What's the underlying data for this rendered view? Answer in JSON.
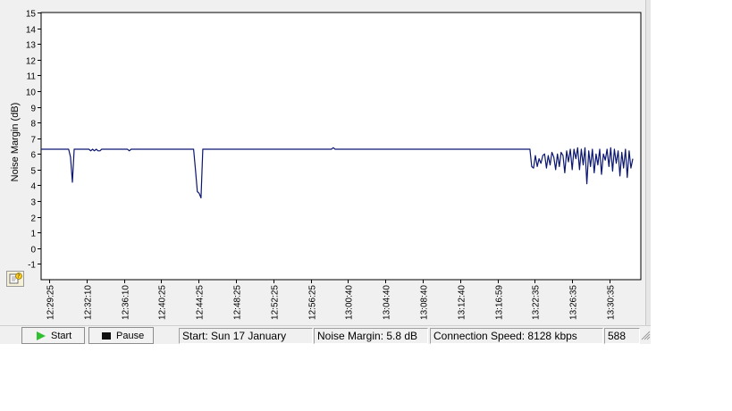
{
  "chart_data": {
    "type": "line",
    "ylabel": "Noise Margin (dB)",
    "ylim": [
      -2,
      15
    ],
    "yticks": [
      "15",
      "14",
      "13",
      "12",
      "11",
      "10",
      "9",
      "8",
      "7",
      "6",
      "5",
      "4",
      "3",
      "2",
      "1",
      "0",
      "-1"
    ],
    "x_tick_labels": [
      "12:29:25",
      "12:32:10",
      "12:36:10",
      "12:40:25",
      "12:44:25",
      "12:48:25",
      "12:52:25",
      "12:56:25",
      "13:00:40",
      "13:04:40",
      "13:08:40",
      "13:12:40",
      "13:16:59",
      "13:22:35",
      "13:26:35",
      "13:30:35"
    ],
    "grid": true,
    "line_color": "#0a1670",
    "series": [
      {
        "values": [
          6.3,
          6.3,
          6.3,
          6.3,
          6.3,
          6.3,
          6.3,
          6.3,
          6.3,
          6.3,
          6.3,
          6.3,
          6.3,
          6.3,
          6.3,
          6.3,
          5.8,
          4.2,
          6.3,
          6.3,
          6.3,
          6.3,
          6.3,
          6.3,
          6.3,
          6.3,
          6.3,
          6.2,
          6.3,
          6.2,
          6.3,
          6.2,
          6.2,
          6.3,
          6.3,
          6.3,
          6.3,
          6.3,
          6.3,
          6.3,
          6.3,
          6.3,
          6.3,
          6.3,
          6.3,
          6.3,
          6.3,
          6.3,
          6.2,
          6.3,
          6.3,
          6.3,
          6.3,
          6.3,
          6.3,
          6.3,
          6.3,
          6.3,
          6.3,
          6.3,
          6.3,
          6.3,
          6.3,
          6.3,
          6.3,
          6.3,
          6.3,
          6.3,
          6.3,
          6.3,
          6.3,
          6.3,
          6.3,
          6.3,
          6.3,
          6.3,
          6.3,
          6.3,
          6.3,
          6.3,
          6.3,
          6.3,
          6.3,
          6.3,
          5.0,
          3.6,
          3.5,
          3.2,
          6.3,
          6.3,
          6.3,
          6.3,
          6.3,
          6.3,
          6.3,
          6.3,
          6.3,
          6.3,
          6.3,
          6.3,
          6.3,
          6.3,
          6.3,
          6.3,
          6.3,
          6.3,
          6.3,
          6.3,
          6.3,
          6.3,
          6.3,
          6.3,
          6.3,
          6.3,
          6.3,
          6.3,
          6.3,
          6.3,
          6.3,
          6.3,
          6.3,
          6.3,
          6.3,
          6.3,
          6.3,
          6.3,
          6.3,
          6.3,
          6.3,
          6.3,
          6.3,
          6.3,
          6.3,
          6.3,
          6.3,
          6.3,
          6.3,
          6.3,
          6.3,
          6.3,
          6.3,
          6.3,
          6.3,
          6.3,
          6.3,
          6.3,
          6.3,
          6.3,
          6.3,
          6.3,
          6.3,
          6.3,
          6.3,
          6.3,
          6.3,
          6.3,
          6.3,
          6.3,
          6.3,
          6.4,
          6.3,
          6.3,
          6.3,
          6.3,
          6.3,
          6.3,
          6.3,
          6.3,
          6.3,
          6.3,
          6.3,
          6.3,
          6.3,
          6.3,
          6.3,
          6.3,
          6.3,
          6.3,
          6.3,
          6.3,
          6.3,
          6.3,
          6.3,
          6.3,
          6.3,
          6.3,
          6.3,
          6.3,
          6.3,
          6.3,
          6.3,
          6.3,
          6.3,
          6.3,
          6.3,
          6.3,
          6.3,
          6.3,
          6.3,
          6.3,
          6.3,
          6.3,
          6.3,
          6.3,
          6.3,
          6.3,
          6.3,
          6.3,
          6.3,
          6.3,
          6.3,
          6.3,
          6.3,
          6.3,
          6.3,
          6.3,
          6.3,
          6.3,
          6.3,
          6.3,
          6.3,
          6.3,
          6.3,
          6.3,
          6.3,
          6.3,
          6.3,
          6.3,
          6.3,
          6.3,
          6.3,
          6.3,
          6.3,
          6.3,
          6.3,
          6.3,
          6.3,
          6.3,
          6.3,
          6.3,
          6.3,
          6.3,
          6.3,
          6.3,
          6.3,
          6.3,
          6.3,
          6.3,
          6.3,
          6.3,
          6.3,
          6.3,
          6.3,
          6.3,
          6.3,
          6.3,
          6.3,
          6.3,
          6.3,
          6.3,
          6.3,
          6.3,
          6.3,
          6.3,
          6.3,
          6.3,
          6.3,
          5.2,
          5.1,
          5.9,
          5.2,
          5.7,
          5.4,
          5.9,
          6.0,
          5.1,
          5.9,
          5.3,
          6.1,
          5.8,
          5.0,
          6.0,
          5.2,
          6.1,
          5.9,
          4.8,
          6.2,
          5.5,
          6.3,
          5.0,
          6.3,
          5.7,
          6.4,
          5.0,
          6.3,
          5.3,
          6.4,
          4.1,
          6.2,
          5.2,
          6.3,
          4.8,
          6.0,
          5.3,
          6.3,
          4.7,
          6.0,
          5.6,
          6.3,
          5.2,
          6.4,
          4.9,
          6.3,
          5.4,
          6.2,
          4.6,
          6.1,
          5.1,
          6.3,
          4.5,
          6.2,
          5.1,
          5.7
        ]
      }
    ]
  },
  "buttons": {
    "start_label": "Start",
    "pause_label": "Pause"
  },
  "status": {
    "start": "Start: Sun 17 January",
    "noise_margin": "Noise Margin: 5.8 dB",
    "connection_speed": "Connection Speed: 8128 kbps",
    "count": "588"
  },
  "icons": {
    "help": "help-question-icon",
    "start": "play-triangle-icon",
    "pause": "stop-square-icon",
    "grip": "resize-grip-icon"
  }
}
